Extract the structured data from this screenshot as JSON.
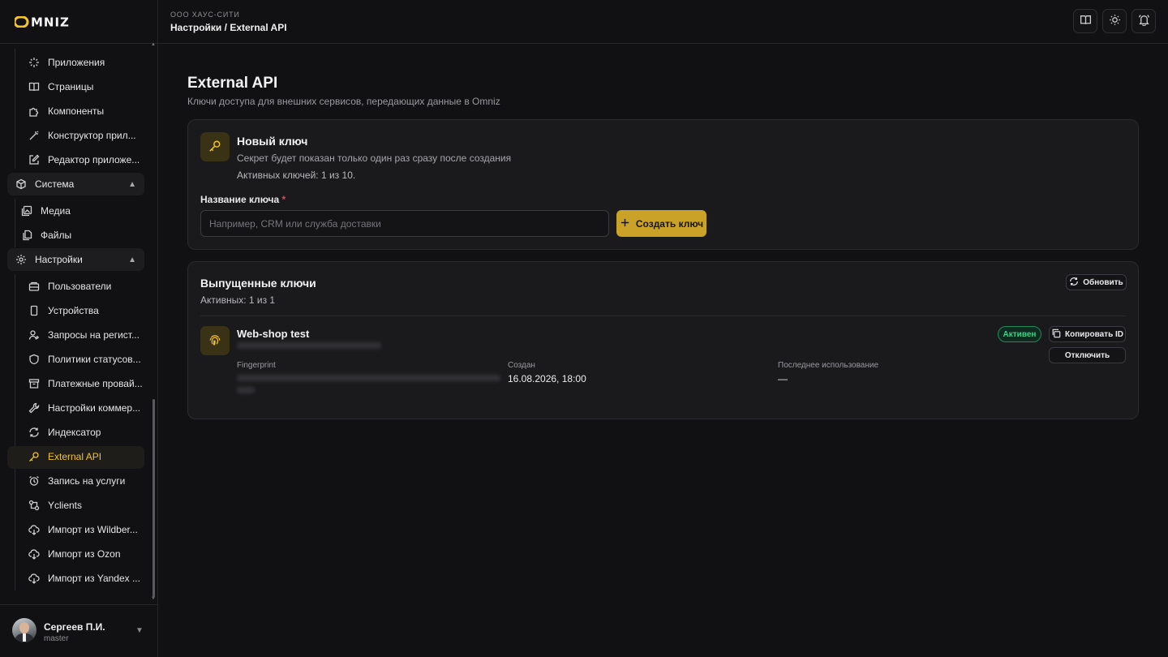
{
  "brand": {
    "logo_text": "OMNIZ"
  },
  "header": {
    "org": "ООО ХАУС-СИТИ",
    "breadcrumb": "Настройки / External API",
    "buttons": [
      "book-icon",
      "sun-icon",
      "bell-icon"
    ]
  },
  "sidebar": {
    "apps_children": [
      {
        "label": "Приложения",
        "icon": "sparkles-icon"
      },
      {
        "label": "Страницы",
        "icon": "book-icon"
      },
      {
        "label": "Компоненты",
        "icon": "puzzle-icon"
      },
      {
        "label": "Конструктор прил...",
        "icon": "wand-icon"
      },
      {
        "label": "Редактор приложе...",
        "icon": "edit-icon"
      }
    ],
    "system_group": {
      "label": "Система",
      "icon": "box-icon"
    },
    "system_children": [
      {
        "label": "Медиа",
        "icon": "images-icon"
      },
      {
        "label": "Файлы",
        "icon": "files-icon"
      }
    ],
    "settings_group": {
      "label": "Настройки",
      "icon": "gear-icon"
    },
    "settings_children": [
      {
        "label": "Пользователи",
        "icon": "users-icon"
      },
      {
        "label": "Устройства",
        "icon": "phone-icon"
      },
      {
        "label": "Запросы на регист...",
        "icon": "user-plus-icon"
      },
      {
        "label": "Политики статусов...",
        "icon": "shield-icon"
      },
      {
        "label": "Платежные провай...",
        "icon": "archive-icon"
      },
      {
        "label": "Настройки коммер...",
        "icon": "wrench-icon"
      },
      {
        "label": "Индексатор",
        "icon": "refresh-icon"
      },
      {
        "label": "External API",
        "icon": "key-icon",
        "active": true
      },
      {
        "label": "Запись на услуги",
        "icon": "alarm-icon"
      },
      {
        "label": "Yclients",
        "icon": "flow-icon"
      },
      {
        "label": "Импорт из Wildber...",
        "icon": "cloud-download-icon"
      },
      {
        "label": "Импорт из Ozon",
        "icon": "cloud-download-icon"
      },
      {
        "label": "Импорт из Yandex ...",
        "icon": "cloud-download-icon"
      }
    ],
    "profile": {
      "name": "Сергеев П.И.",
      "role": "master"
    }
  },
  "page": {
    "title": "External API",
    "subtitle": "Ключи доступа для внешних сервисов, передающих данные в Omniz"
  },
  "new_key": {
    "title": "Новый ключ",
    "description": "Секрет будет показан только один раз сразу после создания",
    "active_count": "Активных ключей: 1 из 10.",
    "field_label": "Название ключа",
    "required_mark": "*",
    "placeholder": "Например, CRM или служба доставки",
    "value": "",
    "create_button": "Создать ключ"
  },
  "issued_keys": {
    "title": "Выпущенные ключи",
    "active_count": "Активных: 1 из 1",
    "refresh_button": "Обновить",
    "keys": [
      {
        "name": "Web-shop test",
        "status": "Активен",
        "copy_button": "Копировать ID",
        "disable_button": "Отключить",
        "fingerprint_label": "Fingerprint",
        "created_label": "Создан",
        "created_value": "16.08.2026, 18:00",
        "last_used_label": "Последнее использование",
        "last_used_value": "—"
      }
    ]
  },
  "colors": {
    "accent": "#f1c232",
    "accent_button": "#c9a227",
    "status_green": "#3fd18a",
    "background": "#111113",
    "card": "#1a1a1c"
  }
}
